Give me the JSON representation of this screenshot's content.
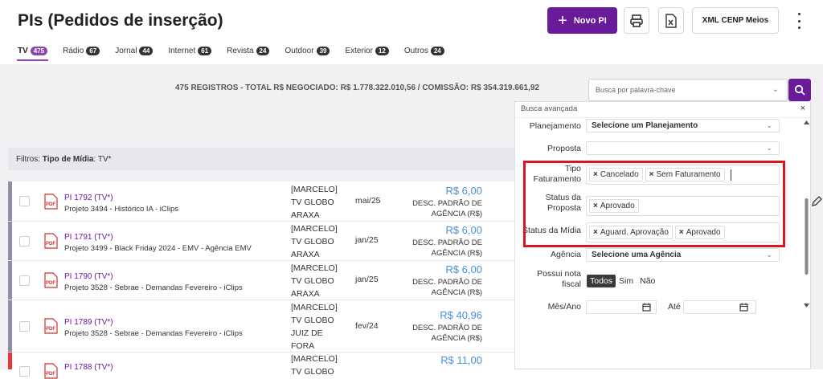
{
  "header": {
    "title": "PIs (Pedidos de inserção)",
    "new_label": "Novo PI",
    "xml_label": "XML CENP Meios",
    "accent": "#6a1b9a"
  },
  "tabs": [
    {
      "label": "TV",
      "count": "475",
      "active": true
    },
    {
      "label": "Rádio",
      "count": "67"
    },
    {
      "label": "Jornal",
      "count": "44"
    },
    {
      "label": "Internet",
      "count": "61"
    },
    {
      "label": "Revista",
      "count": "24"
    },
    {
      "label": "Outdoor",
      "count": "39"
    },
    {
      "label": "Exterior",
      "count": "12"
    },
    {
      "label": "Outros",
      "count": "24"
    }
  ],
  "summary": "475 REGISTROS - TOTAL R$ NEGOCIADO: R$ 1.778.322.010,56 / COMISSÃO: R$ 354.319.661,92",
  "search": {
    "placeholder": "Busca por palavra-chave"
  },
  "filters": {
    "prefix": "Filtros:",
    "key": "Tipo de Mídia",
    "value": ": TV*"
  },
  "rows": [
    {
      "id": "PI 1792 (TV*)",
      "project": "Projeto 3494 - Histórico IA - iClips",
      "vehicle": [
        "[MARCELO]",
        "TV GLOBO",
        "ARAXA"
      ],
      "month": "mai/25",
      "value": "R$ 6,00",
      "desc": [
        "DESC. PADRÃO DE",
        "AGÊNCIA (R$)"
      ]
    },
    {
      "id": "PI 1791 (TV*)",
      "project": "Projeto 3499 - Black Friday 2024 - EMV - Agência EMV",
      "vehicle": [
        "[MARCELO]",
        "TV GLOBO",
        "ARAXA"
      ],
      "month": "jan/25",
      "value": "R$ 6,00",
      "desc": [
        "DESC. PADRÃO DE",
        "AGÊNCIA (R$)"
      ]
    },
    {
      "id": "PI 1790 (TV*)",
      "project": "Projeto 3528 - Sebrae - Demandas Fevereiro - iClips",
      "vehicle": [
        "[MARCELO]",
        "TV GLOBO",
        "ARAXA"
      ],
      "month": "jan/25",
      "value": "R$ 6,00",
      "desc": [
        "DESC. PADRÃO DE",
        "AGÊNCIA (R$)"
      ]
    },
    {
      "id": "PI 1789 (TV*)",
      "project": "Projeto 3528 - Sebrae - Demandas Fevereiro - iClips",
      "vehicle": [
        "[MARCELO]",
        "TV GLOBO",
        "JUIZ DE",
        "FORA"
      ],
      "month": "fev/24",
      "value": "R$ 40,96",
      "desc": [
        "DESC. PADRÃO DE",
        "AGÊNCIA (R$)"
      ]
    },
    {
      "id": "PI 1788 (TV*)",
      "project": "",
      "vehicle": [
        "[MARCELO]",
        "TV GLOBO"
      ],
      "month": "",
      "value": "R$ 11,00",
      "desc": []
    }
  ],
  "panel": {
    "title": "Busca avançada",
    "planejamento": {
      "label": "Planejamento",
      "value": "Selecione um Planejamento"
    },
    "proposta": {
      "label": "Proposta",
      "value": ""
    },
    "tipo_faturamento": {
      "label": [
        "Tipo",
        "Faturamento"
      ],
      "tags": [
        "Cancelado",
        "Sem Faturamento"
      ]
    },
    "status_proposta": {
      "label": [
        "Status da",
        "Proposta"
      ],
      "tags": [
        "Aprovado"
      ]
    },
    "status_midia": {
      "label": "Status da Mídia",
      "tags": [
        "Aguard. Aprovação",
        "Aprovado"
      ]
    },
    "agencia": {
      "label": "Agência",
      "value": "Selecione uma Agência"
    },
    "nota_fiscal": {
      "label": [
        "Possui nota",
        "fiscal"
      ],
      "options": [
        "Todos",
        "Sim",
        "Não"
      ],
      "selected": "Todos"
    },
    "mes_ano": {
      "label": "Mês/Ano",
      "ate": "Até"
    }
  }
}
